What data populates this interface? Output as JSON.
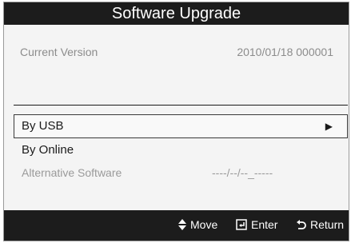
{
  "window": {
    "title": "Software Upgrade"
  },
  "info": {
    "current_version_label": "Current Version",
    "current_version_value": "2010/01/18 000001"
  },
  "menu": {
    "items": [
      {
        "label": "By USB",
        "selected": true,
        "icon": "play-arrow-icon"
      },
      {
        "label": "By Online",
        "selected": false
      },
      {
        "label": "Alternative Software",
        "value": "----/--/--_-----",
        "enabled": false
      }
    ]
  },
  "footer": {
    "move_label": "Move",
    "move_icon": "up-down-arrow-icon",
    "enter_label": "Enter",
    "enter_icon": "enter-icon",
    "return_label": "Return",
    "return_icon": "return-icon"
  },
  "colors": {
    "title_bar": "#1c1c1c",
    "panel": "#f4f4f4",
    "muted_text": "#8c8c8c"
  }
}
